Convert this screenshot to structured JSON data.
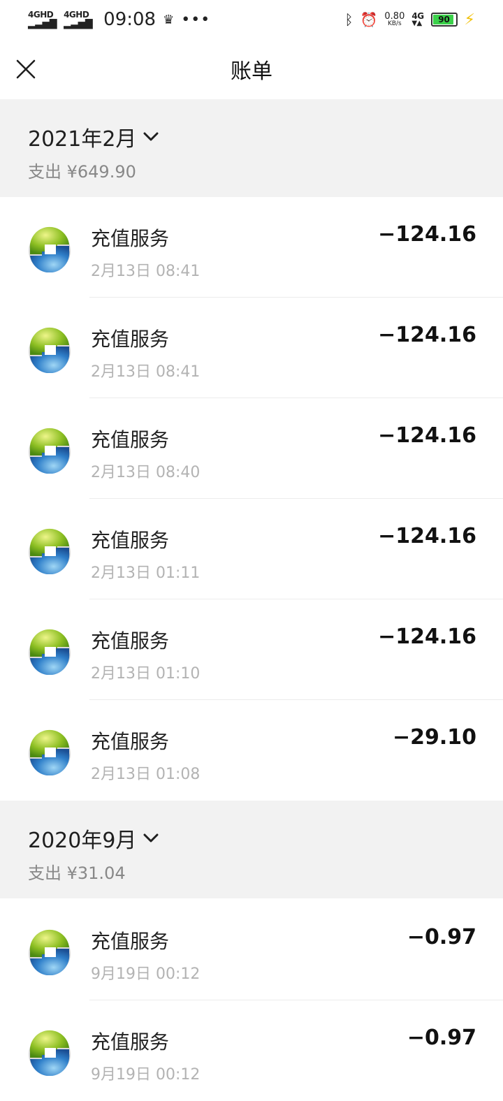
{
  "status_bar": {
    "net1": "4GHD",
    "net2": "4GHD",
    "time": "09:08",
    "speed_value": "0.80",
    "speed_unit": "KB/s",
    "net3": "4G",
    "battery": "90",
    "battery_level": 0.9
  },
  "nav": {
    "title": "账单"
  },
  "sections": [
    {
      "month": "2021年2月",
      "summary": "支出 ¥649.90",
      "transactions": [
        {
          "title": "充值服务",
          "time": "2月13日 08:41",
          "amount": "−124.16"
        },
        {
          "title": "充值服务",
          "time": "2月13日 08:41",
          "amount": "−124.16"
        },
        {
          "title": "充值服务",
          "time": "2月13日 08:40",
          "amount": "−124.16"
        },
        {
          "title": "充值服务",
          "time": "2月13日 01:11",
          "amount": "−124.16"
        },
        {
          "title": "充值服务",
          "time": "2月13日 01:10",
          "amount": "−124.16"
        },
        {
          "title": "充值服务",
          "time": "2月13日 01:08",
          "amount": "−29.10"
        }
      ]
    },
    {
      "month": "2020年9月",
      "summary": "支出 ¥31.04",
      "transactions": [
        {
          "title": "充值服务",
          "time": "9月19日 00:12",
          "amount": "−0.97"
        },
        {
          "title": "充值服务",
          "time": "9月19日 00:12",
          "amount": "−0.97"
        }
      ]
    }
  ],
  "icons": {
    "close": "close-icon",
    "month_dropdown": "chevron-down-icon",
    "merchant": "merchant-logo-icon"
  }
}
